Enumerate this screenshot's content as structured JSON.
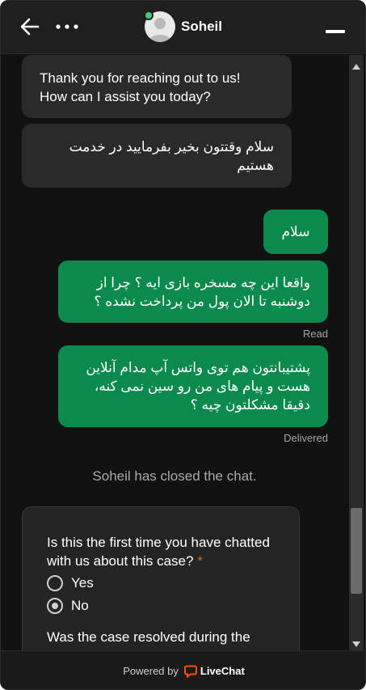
{
  "header": {
    "agent_name": "Soheil",
    "status_color": "#42c97a"
  },
  "messages": {
    "agent_1": "Thank you for reaching out to us!\nHow can I assist you today?",
    "agent_2": "سلام وقتتون بخیر بفرمایید در خدمت\nهستیم",
    "user_1": "سلام",
    "user_2": "واقعا این چه مسخره بازی ایه ؟ چرا از\nدوشنبه تا الان پول من پرداخت نشده ؟",
    "user_2_status": "Read",
    "user_3": "پشتیبانتون هم توی واتس آپ مدام آنلاین\nهست و پیام های من رو سین نمی کنه،\nدقیقا مشکلتون چیه ؟",
    "user_3_status": "Delivered"
  },
  "system": {
    "closed": "Soheil has closed the chat."
  },
  "survey": {
    "q1": "Is this the first time you have chatted with us about this case?",
    "q1_required": "*",
    "options": [
      "Yes",
      "No"
    ],
    "selected": "No",
    "q2": "Was the case resolved during the chat?"
  },
  "footer": {
    "powered_by": "Powered by",
    "brand": "LiveChat",
    "brand_color": "#ff5100"
  },
  "colors": {
    "user_bubble": "#0b8a4e",
    "agent_bubble": "#2a2a2a",
    "background": "#111111"
  }
}
